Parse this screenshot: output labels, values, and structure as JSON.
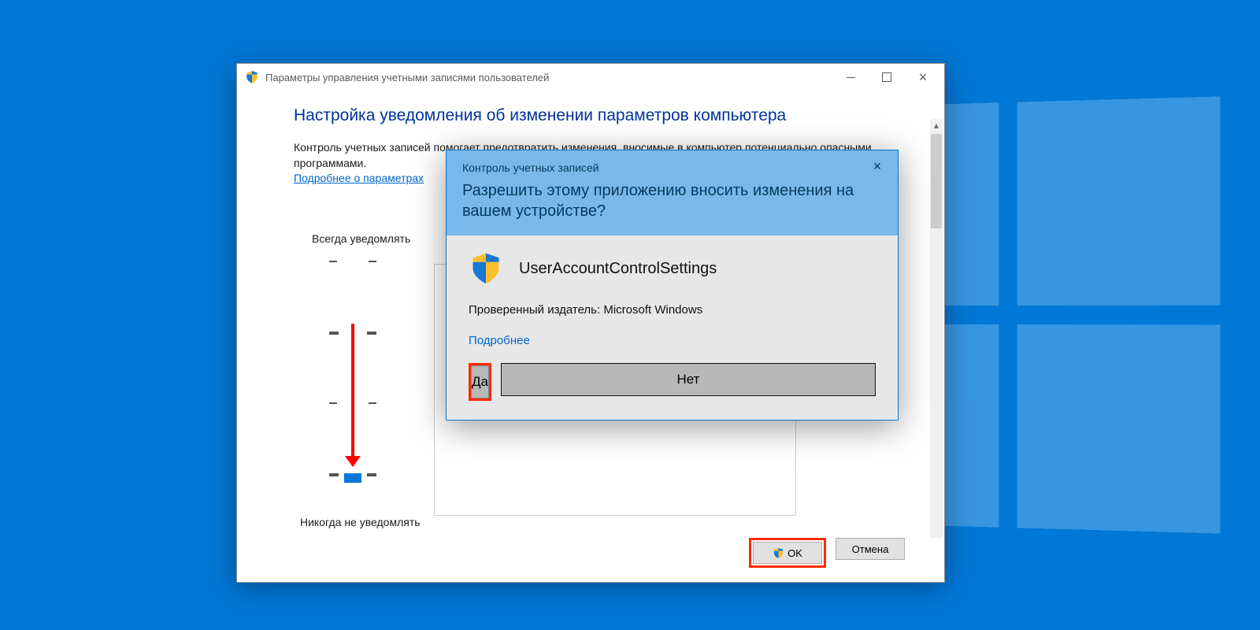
{
  "window": {
    "title": "Параметры управления учетными записями пользователей",
    "heading": "Настройка уведомления об изменении параметров компьютера",
    "description": "Контроль учетных записей помогает предотвратить изменения, вносимые в компьютер потенциально опасными программами.",
    "link": "Подробнее о параметрах",
    "slider_top": "Всегда уведомлять",
    "slider_bottom": "Никогда не уведомлять",
    "ok": "OK",
    "cancel": "Отмена"
  },
  "uac": {
    "subhead": "Контроль учетных записей",
    "question": "Разрешить этому приложению вносить изменения на вашем устройстве?",
    "app": "UserAccountControlSettings",
    "publisher": "Проверенный издатель: Microsoft Windows",
    "details": "Подробнее",
    "yes": "Да",
    "no": "Нет"
  }
}
